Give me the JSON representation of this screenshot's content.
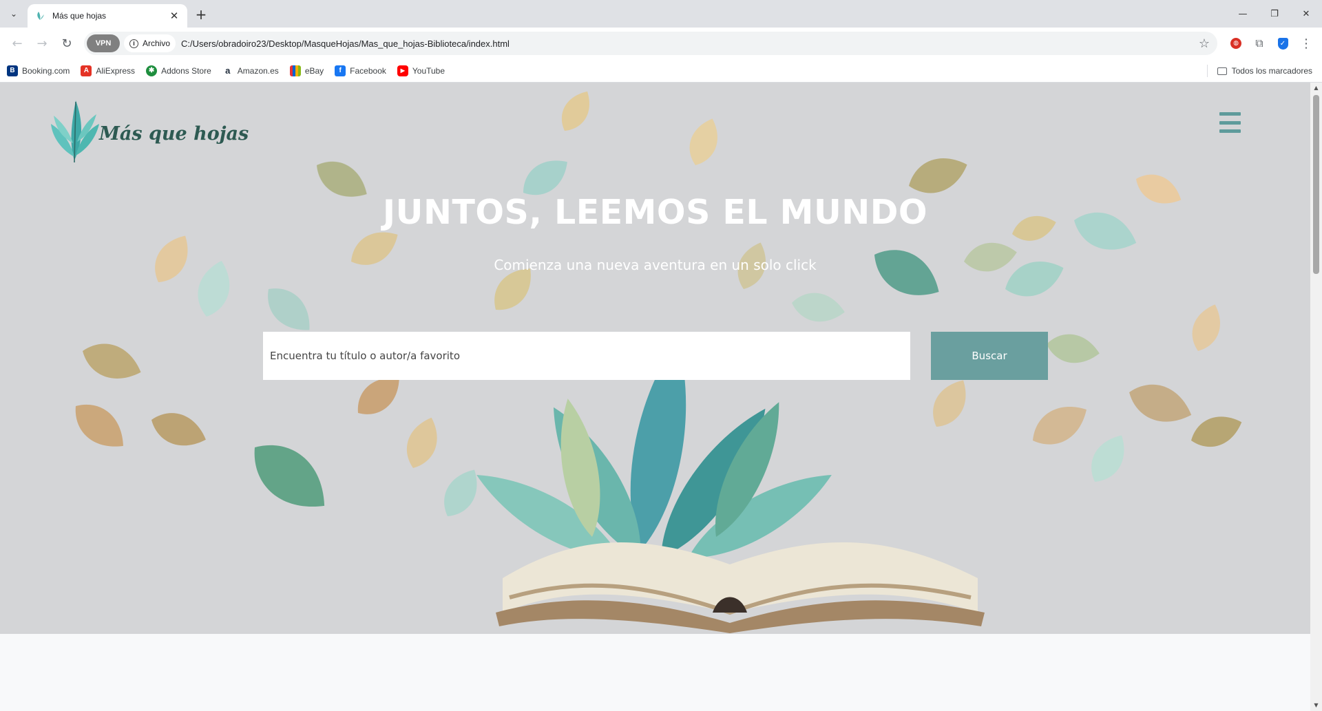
{
  "browser": {
    "tab_title": "Más que hojas",
    "tab_menu_icon": "chevron-down-icon",
    "new_tab_symbol": "+",
    "close_symbol": "✕",
    "window_controls": [
      "—",
      "❐",
      "✕"
    ],
    "vpn_label": "VPN",
    "site_info_label": "Archivo",
    "url": "C:/Users/obradoiro23/Desktop/MasqueHojas/Mas_que_hojas-Biblioteca/index.html"
  },
  "bookmarks": {
    "items": [
      {
        "label": "Booking.com",
        "icon": "booking-icon",
        "color": "#003580",
        "glyph": "B"
      },
      {
        "label": "AliExpress",
        "icon": "aliexpress-icon",
        "color": "#e43225",
        "glyph": "A"
      },
      {
        "label": "Addons Store",
        "icon": "addons-store-icon",
        "color": "#1e8e3e",
        "glyph": "✱"
      },
      {
        "label": "Amazon.es",
        "icon": "amazon-icon",
        "color": "#232f3e",
        "glyph": "a"
      },
      {
        "label": "eBay",
        "icon": "ebay-icon",
        "color": "#e53238",
        "glyph": "e"
      },
      {
        "label": "Facebook",
        "icon": "facebook-icon",
        "color": "#1877f2",
        "glyph": "f"
      },
      {
        "label": "YouTube",
        "icon": "youtube-icon",
        "color": "#ff0000",
        "glyph": "▶"
      }
    ],
    "all_label": "Todos los marcadores"
  },
  "page": {
    "logo_text": "Más que hojas",
    "hero_title": "JUNTOS, LEEMOS EL MUNDO",
    "hero_subtitle": "Comienza una nueva aventura en un solo click",
    "search_placeholder": "Encuentra tu título o autor/a favorito",
    "search_button": "Buscar"
  },
  "colors": {
    "accent": "#6a9f9f",
    "logo_text": "#2d5a52",
    "hero_bg": "#d4d5d7"
  }
}
